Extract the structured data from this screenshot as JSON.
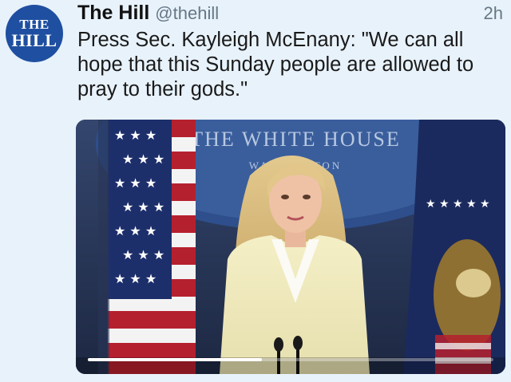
{
  "tweet": {
    "avatar_line1": "THE",
    "avatar_line2": "HILL",
    "display_name": "The Hill",
    "handle": "@thehill",
    "timestamp": "2h",
    "text": "Press Sec. Kayleigh McEnany: \"We can all hope that this Sunday people are allowed to pray to their gods.\""
  },
  "video": {
    "backdrop_text": "THE WHITE HOUSE",
    "backdrop_subtext": "WASHINGTON",
    "progress_fraction": 0.43
  },
  "colors": {
    "background": "#e8f2fb",
    "avatar": "#1f4fa0",
    "secondary_text": "#657786"
  }
}
